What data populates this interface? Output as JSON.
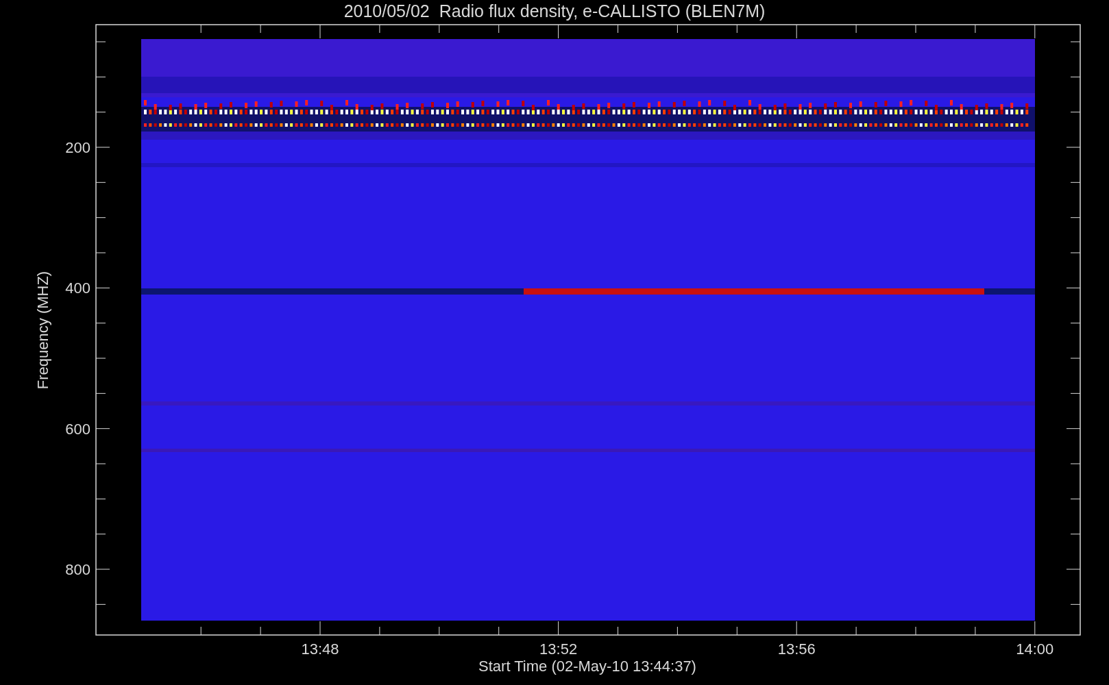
{
  "plot": {
    "title": "2010/05/02  Radio flux density, e-CALLISTO (BLEN7M)",
    "xlabel": "Start Time (02-May-10 13:44:37)",
    "ylabel": "Frequency (MHZ)",
    "x_tick_labels": [
      "13:48",
      "13:52",
      "13:56",
      "14:00"
    ],
    "y_tick_labels": [
      "200",
      "400",
      "600",
      "800"
    ]
  }
}
